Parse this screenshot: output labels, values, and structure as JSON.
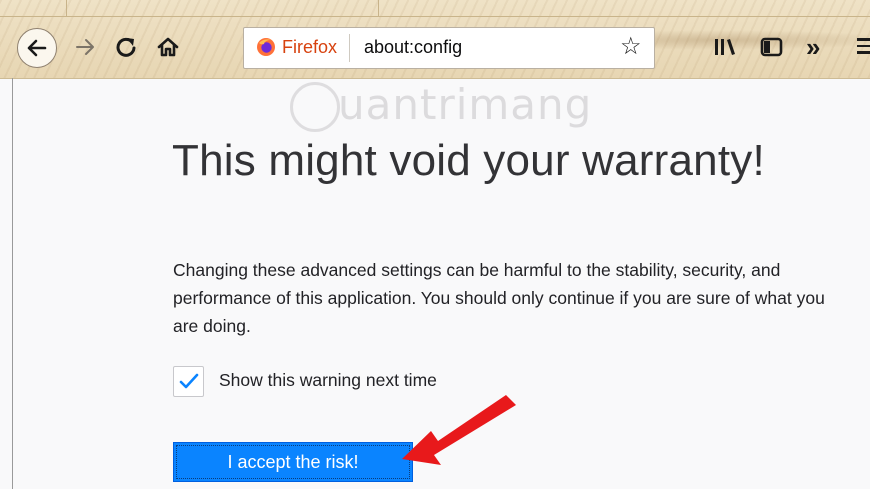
{
  "browser": {
    "brand_label": "Firefox",
    "url": "about:config",
    "accent_color": "#0a84ff",
    "theme": "parchment",
    "icons": {
      "back": "back-arrow-icon",
      "forward": "forward-arrow-icon",
      "reload": "reload-icon",
      "home": "home-icon",
      "bookmark": "star-icon",
      "library": "library-icon",
      "sidebar": "sidebar-icon",
      "overflow": "chevron-double-right-icon",
      "menu": "hamburger-menu-icon"
    }
  },
  "watermark": {
    "text": "uantrimang",
    "icon": "lightbulb-icon"
  },
  "page": {
    "title": "This might void your warranty!",
    "warning_text": "Changing these advanced settings can be harmful to the stability, security, and performance of this application. You should only continue if you are sure of what you are doing.",
    "checkbox": {
      "label": "Show this warning next time",
      "checked": true
    },
    "accept_button_label": "I accept the risk!",
    "annotation": {
      "icon": "red-arrow-icon",
      "color": "#e8191b"
    }
  }
}
